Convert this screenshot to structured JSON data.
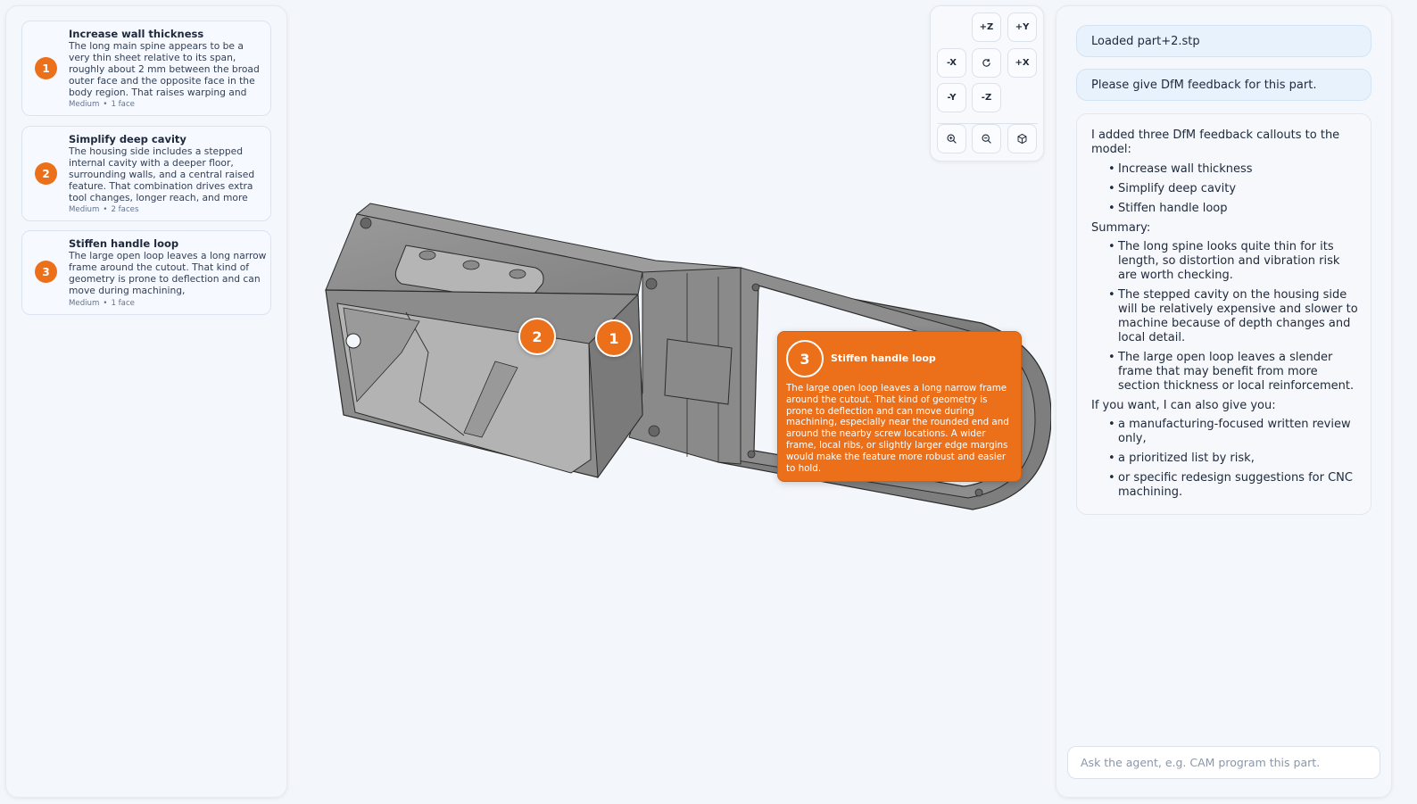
{
  "issues": [
    {
      "number": "1",
      "title": "Increase wall thickness",
      "description": "The long main spine appears to be a very thin sheet relative to its span, roughly about 2 mm between the broad outer face and the opposite face in the body region. That raises warping and",
      "severity": "Medium",
      "faces": "1 face"
    },
    {
      "number": "2",
      "title": "Simplify deep cavity",
      "description": "The housing side includes a stepped internal cavity with a deeper floor, surrounding walls, and a central raised feature. That combination drives extra tool changes, longer reach, and more",
      "severity": "Medium",
      "faces": "2 faces"
    },
    {
      "number": "3",
      "title": "Stiffen handle loop",
      "description": "The large open loop leaves a long narrow frame around the cutout. That kind of geometry is prone to deflection and can move during machining,",
      "severity": "Medium",
      "faces": "1 face"
    }
  ],
  "markers": {
    "m1": "1",
    "m2": "2"
  },
  "callout": {
    "number": "3",
    "title": "Stiffen handle loop",
    "body": "The large open loop leaves a long narrow frame around the cutout. That kind of geometry is prone to deflection and can move during machining, especially near the rounded end and around the nearby screw locations. A wider frame, local ribs, or slightly larger edge margins would make the feature more robust and easier to hold."
  },
  "view_toolbar": {
    "plus_z": "+Z",
    "plus_y": "+Y",
    "minus_x": "-X",
    "plus_x": "+X",
    "minus_y": "-Y",
    "minus_z": "-Z",
    "icons": [
      "reset-view-icon",
      "zoom-in-icon",
      "zoom-out-icon",
      "iso-view-icon"
    ]
  },
  "chat": {
    "user_messages": [
      "Loaded part+2.stp",
      "Please give DfM feedback for this part."
    ],
    "agent": {
      "intro": "I added three DfM feedback callouts to the model:",
      "callouts": [
        "Increase wall thickness",
        "Simplify deep cavity",
        "Stiffen handle loop"
      ],
      "summary_label": "Summary:",
      "summary": [
        "The long spine looks quite thin for its length, so distortion and vibration risk are worth checking.",
        "The stepped cavity on the housing side will be relatively expensive and slower to machine because of depth changes and local detail.",
        "The large open loop leaves a slender frame that may benefit from more section thickness or local reinforcement."
      ],
      "offer_label": "If you want, I can also give you:",
      "offers": [
        "a manufacturing-focused written review only,",
        "a prioritized list by risk,",
        "or specific redesign suggestions for CNC machining."
      ]
    },
    "input_placeholder": "Ask the agent, e.g. CAM program this part."
  },
  "colors": {
    "accent": "#ec6f1a",
    "model_gray": "#8a8a8a"
  }
}
